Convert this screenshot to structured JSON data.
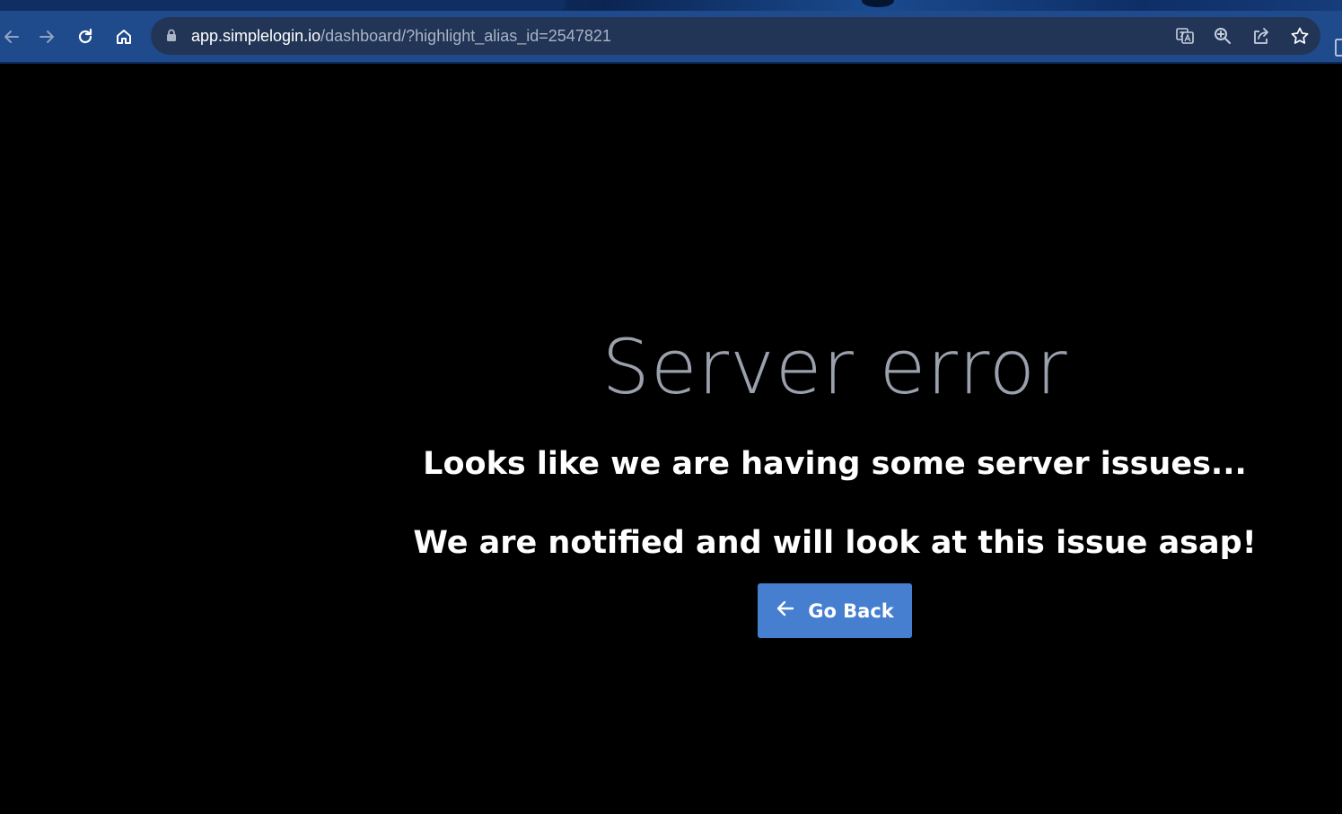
{
  "browser": {
    "url_host": "app.simplelogin.io",
    "url_path": "/dashboard/?highlight_alias_id=2547821",
    "toolbar_icons": [
      "back-arrow-icon",
      "forward-arrow-icon",
      "reload-icon",
      "home-icon"
    ],
    "omnibox_icons": [
      "lock-icon",
      "translate-icon",
      "zoom-icon",
      "share-icon",
      "bookmark-star-icon"
    ],
    "colors": {
      "toolbar": "#1f4a8c",
      "omnibox": "#223556"
    }
  },
  "page": {
    "title": "Server error",
    "message_1": "Looks like we are having some server issues...",
    "message_2": "We are notified and will look at this issue asap!",
    "go_back_label": "Go Back",
    "go_back_icon": "arrow-left-icon",
    "colors": {
      "background": "#000000",
      "title": "#9aa0ac",
      "text": "#ffffff",
      "button": "#467fcf"
    }
  }
}
